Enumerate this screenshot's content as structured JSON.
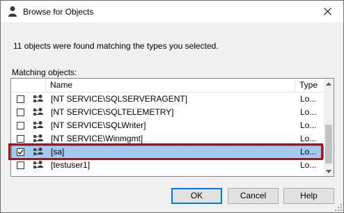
{
  "window": {
    "title": "Browse for Objects"
  },
  "status_text": "11 objects were found matching the types you selected.",
  "list": {
    "label": "Matching objects:",
    "columns": {
      "name": "Name",
      "type": "Type"
    },
    "rows": [
      {
        "name": "[NT SERVICE\\SQLSERVERAGENT]",
        "type": "Lo...",
        "checked": false,
        "selected": false
      },
      {
        "name": "[NT SERVICE\\SQLTELEMETRY]",
        "type": "Lo...",
        "checked": false,
        "selected": false
      },
      {
        "name": "[NT SERVICE\\SQLWriter]",
        "type": "Lo...",
        "checked": false,
        "selected": false
      },
      {
        "name": "[NT SERVICE\\Winmgmt]",
        "type": "Lo...",
        "checked": false,
        "selected": false
      },
      {
        "name": "[sa]",
        "type": "Lo...",
        "checked": true,
        "selected": true
      },
      {
        "name": "[testuser1]",
        "type": "Lo...",
        "checked": false,
        "selected": false
      }
    ]
  },
  "buttons": {
    "ok": "OK",
    "cancel": "Cancel",
    "help": "Help"
  },
  "colors": {
    "selection": "#a3cbf0",
    "highlight_border": "#a3151b",
    "default_button_border": "#0078d7"
  },
  "icons": {
    "title": "user-icon",
    "close": "close-icon",
    "row": "login-user-icon"
  }
}
